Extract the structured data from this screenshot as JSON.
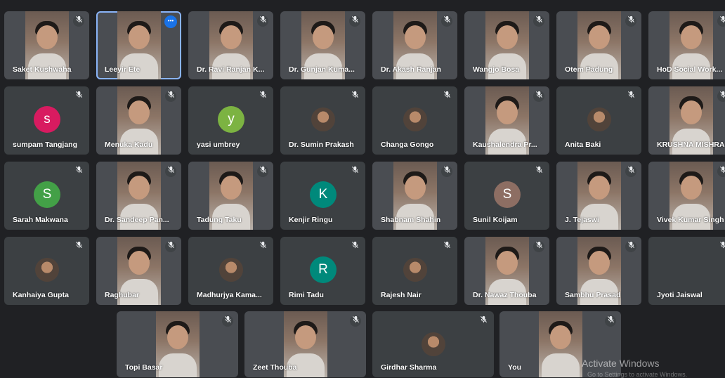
{
  "participants": [
    {
      "name": "Saket Kushwaha",
      "type": "video",
      "muted": true
    },
    {
      "name": "Leeyir Ete",
      "type": "video",
      "muted": false,
      "active": true
    },
    {
      "name": "Dr. Ravi Ranjan K...",
      "type": "video",
      "muted": true
    },
    {
      "name": "Dr. Gunjan Kuma...",
      "type": "video",
      "muted": true
    },
    {
      "name": "Dr. Akash Ranjan",
      "type": "video",
      "muted": true
    },
    {
      "name": "Wangjo Bosa",
      "type": "video",
      "muted": true
    },
    {
      "name": "Otem Padung",
      "type": "video",
      "muted": true
    },
    {
      "name": "HoD Social Work...",
      "type": "video",
      "muted": true
    },
    {
      "name": "sumpam Tangjang",
      "type": "avatar",
      "initial": "s",
      "color": "#d81b60",
      "muted": true
    },
    {
      "name": "Menuka Kadu",
      "type": "video",
      "muted": true
    },
    {
      "name": "yasi umbrey",
      "type": "avatar",
      "initial": "y",
      "color": "#7cb342",
      "muted": true
    },
    {
      "name": "Dr. Sumin Prakash",
      "type": "thumb",
      "muted": true
    },
    {
      "name": "Changa Gongo",
      "type": "thumb",
      "muted": true
    },
    {
      "name": "Kaushalendra Pr...",
      "type": "video",
      "muted": true
    },
    {
      "name": "Anita Baki",
      "type": "thumb",
      "muted": true
    },
    {
      "name": "KRUSHNA MISHRA",
      "type": "video",
      "muted": true
    },
    {
      "name": "Sarah Makwana",
      "type": "avatar",
      "initial": "S",
      "color": "#43a047",
      "muted": true
    },
    {
      "name": "Dr. Sandeep Pan...",
      "type": "video",
      "muted": true
    },
    {
      "name": "Tadung Taku",
      "type": "video",
      "muted": true
    },
    {
      "name": "Kenjir Ringu",
      "type": "avatar",
      "initial": "K",
      "color": "#00897b",
      "muted": true
    },
    {
      "name": "Shabnam Shahin",
      "type": "video",
      "muted": true
    },
    {
      "name": "Sunil Koijam",
      "type": "avatar",
      "initial": "S",
      "color": "#8d6e63",
      "muted": true
    },
    {
      "name": "J. Tejaswi",
      "type": "video",
      "muted": true
    },
    {
      "name": "Vivek Kumar Singh",
      "type": "video",
      "muted": true
    },
    {
      "name": "Kanhaiya Gupta",
      "type": "thumb",
      "muted": true
    },
    {
      "name": "Raghubar",
      "type": "video",
      "muted": true
    },
    {
      "name": "Madhurjya Kama...",
      "type": "thumb",
      "muted": true
    },
    {
      "name": "Rimi Tadu",
      "type": "avatar",
      "initial": "R",
      "color": "#00897b",
      "muted": true
    },
    {
      "name": "Rajesh Nair",
      "type": "thumb",
      "muted": true
    },
    {
      "name": "Dr. Nawaz Thouba",
      "type": "video",
      "muted": true
    },
    {
      "name": "Sambhu Prasad",
      "type": "video",
      "muted": true
    },
    {
      "name": "Jyoti Jaiswal",
      "type": "empty",
      "muted": true
    },
    {
      "name": "Topi Basar",
      "type": "video",
      "muted": true
    },
    {
      "name": "Zeet Thouba",
      "type": "video",
      "muted": true
    },
    {
      "name": "Girdhar Sharma",
      "type": "thumb",
      "muted": true
    },
    {
      "name": "You",
      "type": "video",
      "muted": true
    }
  ],
  "watermark": {
    "title": "Activate Windows",
    "subtitle": "Go to Settings to activate Windows."
  },
  "icons": {
    "mute": "mic-off-icon",
    "more": "more-options-icon"
  }
}
